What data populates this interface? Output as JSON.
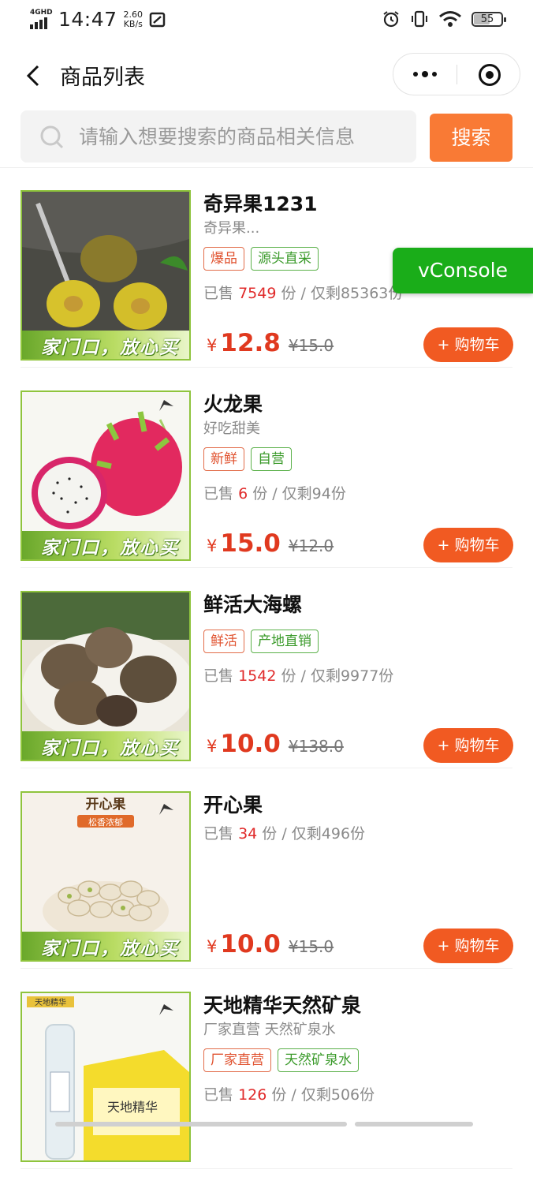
{
  "status": {
    "network": "4GHD",
    "time": "14:47",
    "speed_value": "2.60",
    "speed_unit": "KB/s",
    "battery": "55"
  },
  "nav": {
    "title": "商品列表"
  },
  "search": {
    "placeholder": "请输入想要搜索的商品相关信息",
    "button": "搜索"
  },
  "vconsole": "vConsole",
  "products": [
    {
      "name": "奇异果1231",
      "subtitle": "奇异果...",
      "tags": [
        "爆品",
        "源头直采"
      ],
      "sold_prefix": "已售",
      "sold": "7549",
      "sold_suffix": "份 / 仅剩85363份",
      "currency": "¥",
      "price": "12.8",
      "old_price": "¥15.0",
      "cart": "+ 购物车",
      "banner": "家门口，放心买"
    },
    {
      "name": "火龙果",
      "subtitle": "好吃甜美",
      "tags": [
        "新鲜",
        "自营"
      ],
      "sold_prefix": "已售",
      "sold": "6",
      "sold_suffix": "份 / 仅剩94份",
      "currency": "¥",
      "price": "15.0",
      "old_price": "¥12.0",
      "cart": "+ 购物车",
      "banner": "家门口，放心买"
    },
    {
      "name": "鲜活大海螺",
      "subtitle": "",
      "tags": [
        "鲜活",
        "产地直销"
      ],
      "sold_prefix": "已售",
      "sold": "1542",
      "sold_suffix": "份 / 仅剩9977份",
      "currency": "¥",
      "price": "10.0",
      "old_price": "¥138.0",
      "cart": "+ 购物车",
      "banner": "家门口，放心买"
    },
    {
      "name": "开心果",
      "subtitle": "",
      "tags": [],
      "sold_prefix": "已售",
      "sold": "34",
      "sold_suffix": "份 / 仅剩496份",
      "currency": "¥",
      "price": "10.0",
      "old_price": "¥15.0",
      "cart": "+ 购物车",
      "banner": "家门口，放心买",
      "image_text": "开心果",
      "image_sub": "松香浓郁"
    },
    {
      "name": "天地精华天然矿泉",
      "subtitle": "厂家直营 天然矿泉水",
      "tags": [
        "厂家直营",
        "天然矿泉水"
      ],
      "sold_prefix": "已售",
      "sold": "126",
      "sold_suffix": "份 / 仅剩506份",
      "currency": "¥",
      "price": "",
      "old_price": "",
      "cart": "",
      "banner": "",
      "image_text": "天地精华"
    }
  ]
}
